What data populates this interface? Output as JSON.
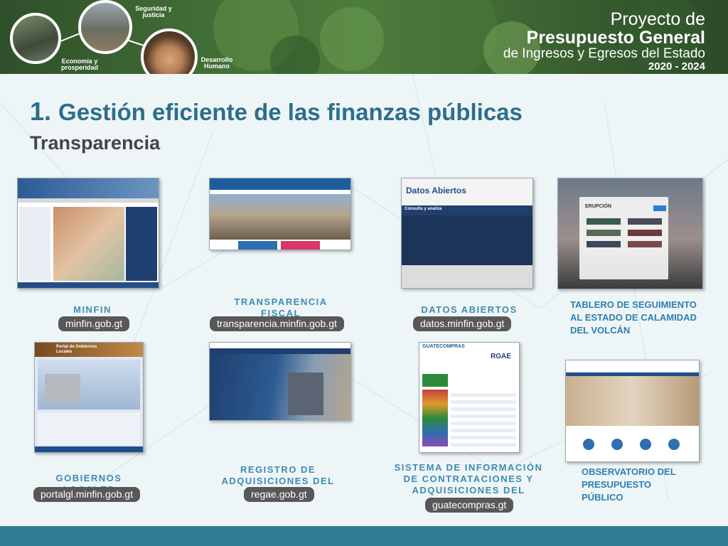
{
  "banner": {
    "labels": {
      "seguridad": "Seguridad y justicia",
      "economia": "Economía y prosperidad",
      "desarrollo": "Desarrollo Humano"
    },
    "brand": {
      "line1": "Proyecto de",
      "line2": "Presupuesto General",
      "line3": "de Ingresos y Egresos del Estado",
      "line4": "2020 - 2024"
    }
  },
  "heading": {
    "number": "1.",
    "title": "Gestión eficiente de las finanzas públicas"
  },
  "subheading": "Transparencia",
  "items": [
    {
      "caption": "MINFIN",
      "url": "minfin.gob.gt"
    },
    {
      "caption": "TRANSPARENCIA FISCAL",
      "url": "transparencia.minfin.gob.gt"
    },
    {
      "caption": "DATOS ABIERTOS",
      "url": "datos.minfin.gob.gt"
    },
    {
      "caption": "TABLERO DE SEGUIMIENTO AL ESTADO DE CALAMIDAD DEL VOLCÁN",
      "url": ""
    },
    {
      "caption": "GOBIERNOS LOCALES",
      "url": "portalgl.minfin.gob.gt"
    },
    {
      "caption": "REGISTRO DE ADQUISICIONES DEL ESTADO",
      "url": "regae.gob.gt"
    },
    {
      "caption": "SISTEMA DE INFORMACIÓN DE CONTRATACIONES Y ADQUISICIONES DEL ESTADO",
      "url": "guatecompras.gt"
    },
    {
      "caption": "OBSERVATORIO DEL PRESUPUESTO PÚBLICO",
      "url": ""
    }
  ],
  "thumb_text": {
    "datos_title": "Datos Abiertos",
    "datos_sub": "Consulta y analiza",
    "erupcion": "ERUPCIÓN",
    "portal": "Portal de Gobiernos Locales",
    "guatecompras": "GUATECOMPRAS",
    "rgae": "RGAE"
  }
}
